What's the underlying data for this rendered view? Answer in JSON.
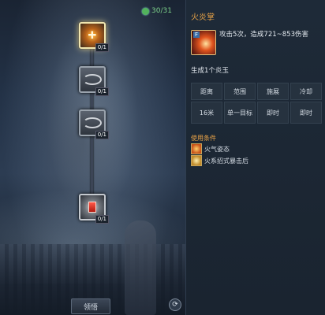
{
  "tree": {
    "points": "30/31",
    "nodes": [
      {
        "count": "0/1",
        "state": "active",
        "glyph": "✚"
      },
      {
        "count": "0/1",
        "state": "locked"
      },
      {
        "count": "0/1",
        "state": "locked"
      },
      {
        "count": "0/1",
        "state": "selected"
      }
    ],
    "learn_label": "领悟"
  },
  "skill": {
    "name": "火炎掌",
    "key": "F",
    "description": "攻击5次，造成721~853伤害",
    "sub": "生成1个炎玉",
    "stats_headers": [
      "距离",
      "范围",
      "施展",
      "冷却"
    ],
    "stats_values": [
      "16米",
      "单一目标",
      "即时",
      "即时"
    ],
    "conditions_title": "使用条件",
    "conditions": [
      "火气姿态",
      "火系招式暴击后"
    ]
  },
  "colors": {
    "accent": "#e8a347",
    "points": "#7dd18a"
  }
}
